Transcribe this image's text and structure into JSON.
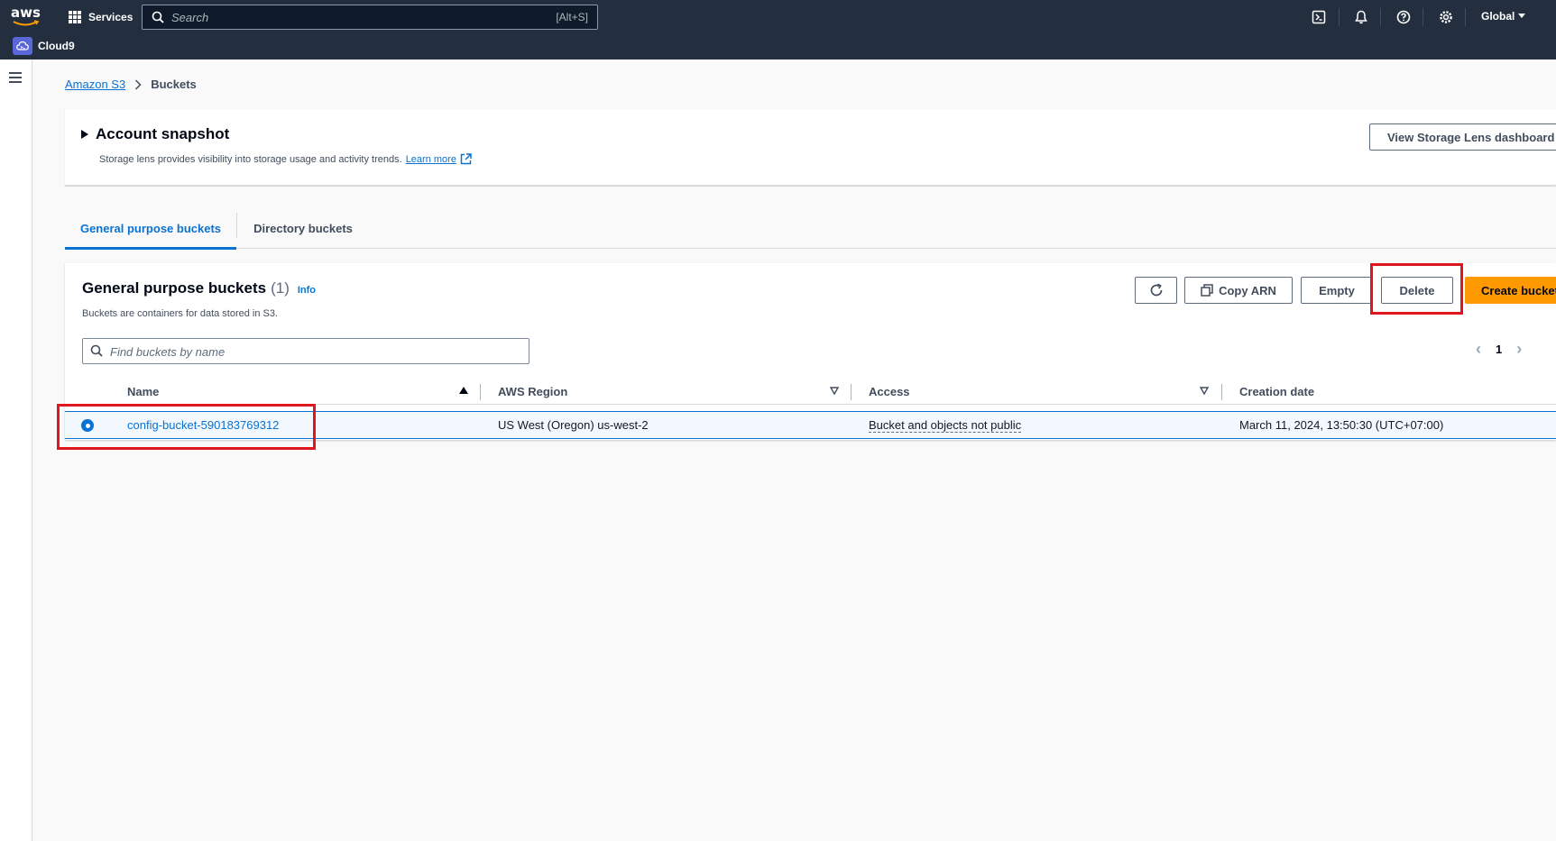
{
  "topnav": {
    "logo": "aws",
    "services_label": "Services",
    "search_placeholder": "Search",
    "search_shortcut": "[Alt+S]",
    "region": "Global",
    "pinned_service": "Cloud9"
  },
  "breadcrumb": {
    "root": "Amazon S3",
    "current": "Buckets"
  },
  "snapshot": {
    "title": "Account snapshot",
    "description": "Storage lens provides visibility into storage usage and activity trends.",
    "learn_more": "Learn more",
    "lens_button": "View Storage Lens dashboard"
  },
  "tabs": [
    {
      "label": "General purpose buckets",
      "active": true
    },
    {
      "label": "Directory buckets",
      "active": false
    }
  ],
  "panel": {
    "title": "General purpose buckets",
    "count": "(1)",
    "info": "Info",
    "description": "Buckets are containers for data stored in S3.",
    "buttons": {
      "copy_arn": "Copy ARN",
      "empty": "Empty",
      "delete": "Delete",
      "create": "Create bucket"
    },
    "filter_placeholder": "Find buckets by name",
    "page": "1"
  },
  "table": {
    "columns": [
      "Name",
      "AWS Region",
      "Access",
      "Creation date"
    ],
    "rows": [
      {
        "name": "config-bucket-590183769312",
        "region": "US West (Oregon) us-west-2",
        "access": "Bucket and objects not public",
        "created": "March 11, 2024, 13:50:30 (UTC+07:00)",
        "selected": true
      }
    ]
  },
  "colors": {
    "nav_bg": "#232f3e",
    "link": "#0972d3",
    "primary_button": "#ff9900",
    "highlight": "#e0161e"
  }
}
